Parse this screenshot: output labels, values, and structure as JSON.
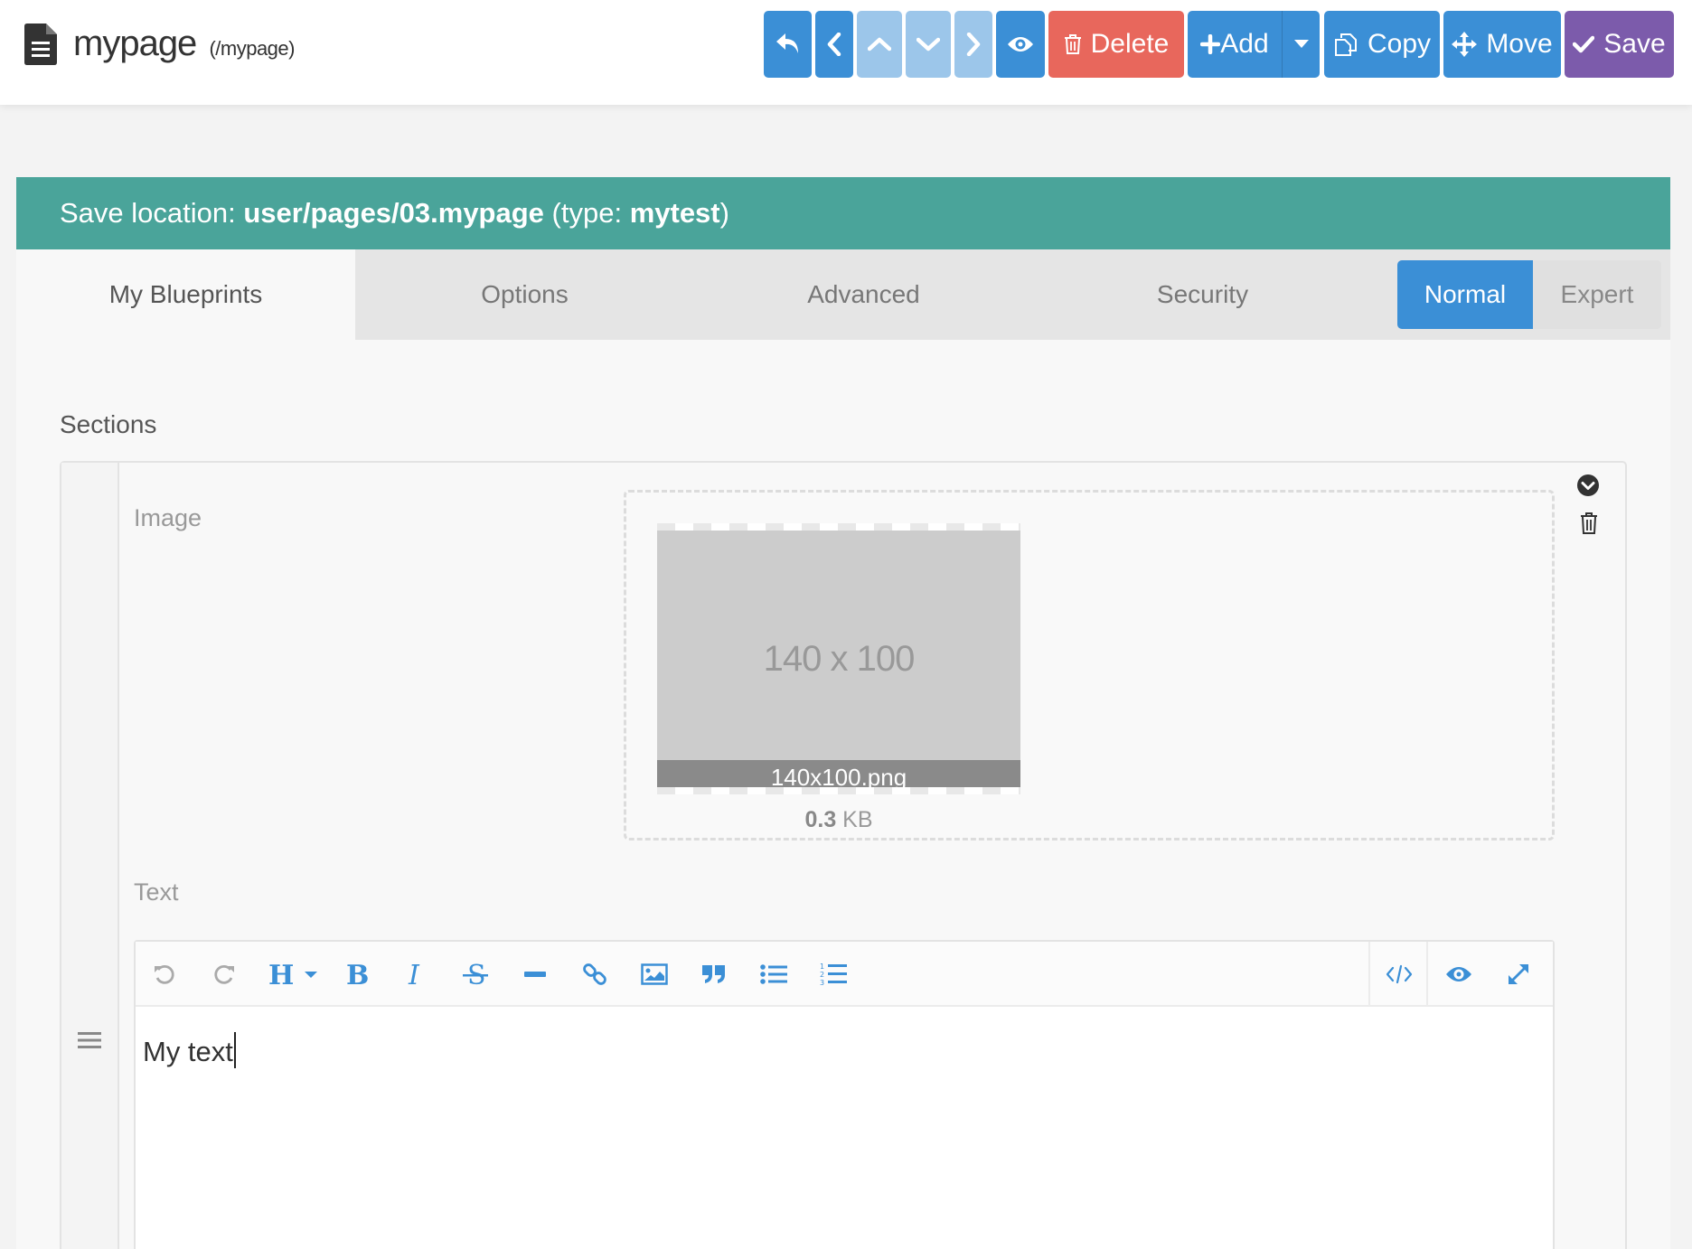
{
  "header": {
    "title": "mypage",
    "route": "(/mypage)",
    "buttons": {
      "delete": "Delete",
      "add": "Add",
      "copy": "Copy",
      "move": "Move",
      "save": "Save"
    }
  },
  "save_location": {
    "prefix": "Save location: ",
    "path": "user/pages/03.mypage",
    "type_prefix": " (type: ",
    "type": "mytest",
    "suffix": ")"
  },
  "tabs": [
    {
      "label": "My Blueprints",
      "active": true
    },
    {
      "label": "Options",
      "active": false
    },
    {
      "label": "Advanced",
      "active": false
    },
    {
      "label": "Security",
      "active": false
    }
  ],
  "mode_toggle": {
    "normal": "Normal",
    "expert": "Expert",
    "selected": "Normal"
  },
  "sections": {
    "label": "Sections",
    "items": [
      {
        "image_label": "Image",
        "image": {
          "placeholder_text": "140 x 100",
          "filename": "140x100.png",
          "size_value": "0.3",
          "size_unit": " KB"
        },
        "text_label": "Text",
        "text_value": "My text"
      }
    ]
  },
  "editor_toolbar": [
    "undo-icon",
    "redo-icon",
    "heading-icon",
    "bold-icon",
    "italic-icon",
    "strikethrough-icon",
    "horizontal-rule-icon",
    "link-icon",
    "image-icon",
    "blockquote-icon",
    "bullet-list-icon",
    "numbered-list-icon",
    "code-icon",
    "preview-icon",
    "fullscreen-icon"
  ],
  "colors": {
    "primary": "#3b8fd6",
    "primary_disabled": "#9cc6ea",
    "danger": "#e8675c",
    "save": "#7c5bab",
    "save_location_bar": "#4aa49a"
  }
}
